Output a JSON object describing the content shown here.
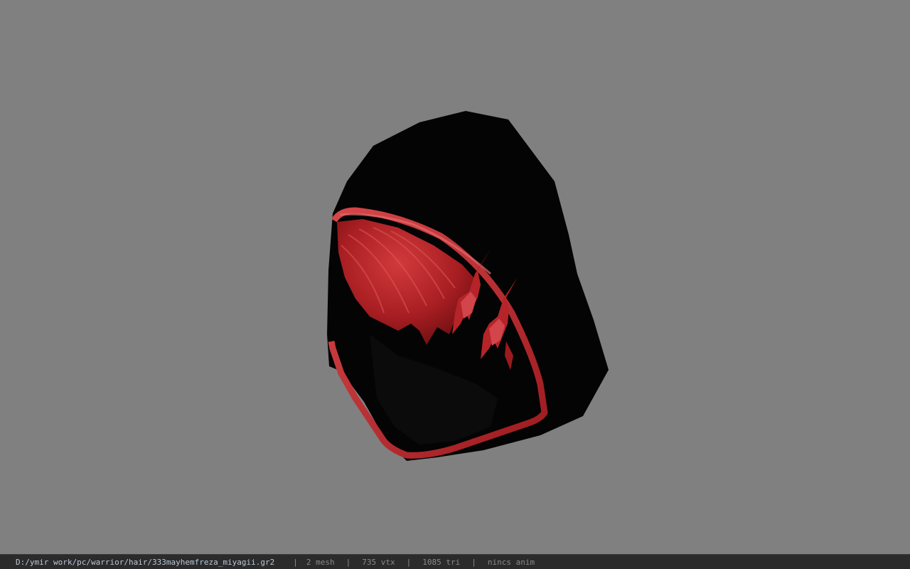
{
  "viewer": {
    "background_color": "#808080",
    "model": {
      "name": "333mayhemfreza_miyagii",
      "hood_color": "#000000",
      "accent_color": "#c0262a"
    }
  },
  "statusbar": {
    "file_path": "D:/ymir work/pc/warrior/hair/333mayhemfreza_miyagii.gr2",
    "separator": "|",
    "mesh": "2 mesh",
    "vertices": "735 vtx",
    "triangles": "1085 tri",
    "animation": "nincs anim"
  }
}
